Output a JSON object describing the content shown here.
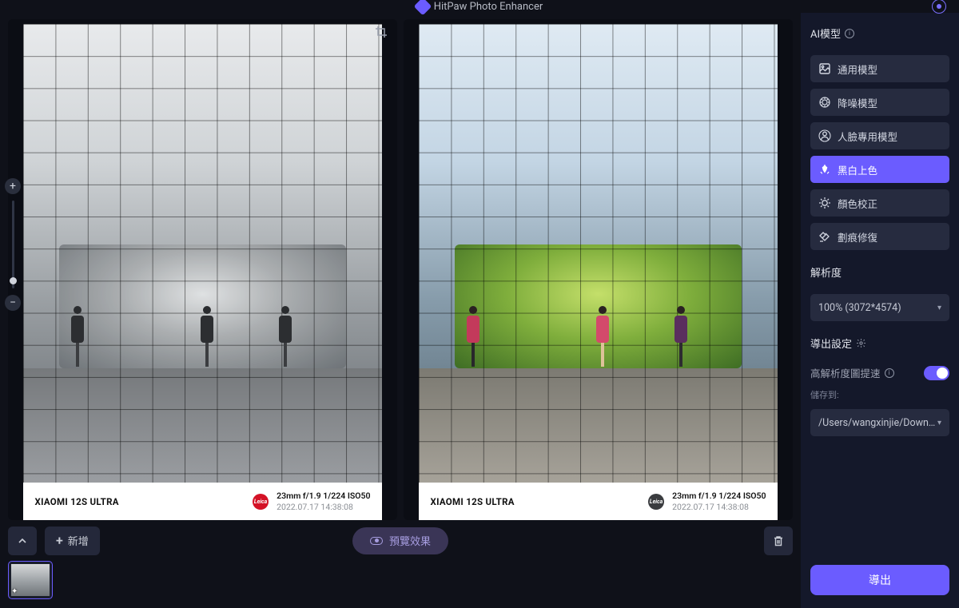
{
  "app": {
    "title": "HitPaw Photo Enhancer"
  },
  "toolbar": {
    "add_label": "新增",
    "preview_label": "預覽效果"
  },
  "photo": {
    "model": "XIAOMI 12S ULTRA",
    "leica": "Leica",
    "exif": "23mm  f/1.9  1/224  ISO50",
    "timestamp": "2022.07.17 14:38:08"
  },
  "sidebar": {
    "ai_models_title": "AI模型",
    "models": [
      {
        "label": "通用模型"
      },
      {
        "label": "降噪模型"
      },
      {
        "label": "人臉專用模型"
      },
      {
        "label": "黑白上色"
      },
      {
        "label": "顏色校正"
      },
      {
        "label": "劃痕修復"
      }
    ],
    "active_model_index": 3,
    "resolution_title": "解析度",
    "resolution_value": "100% (3072*4574)",
    "export_title": "導出設定",
    "hires_label": "高解析度圖提速",
    "save_to_label": "儲存到:",
    "save_path": "/Users/wangxinjie/Downloads",
    "export_button": "導出"
  }
}
